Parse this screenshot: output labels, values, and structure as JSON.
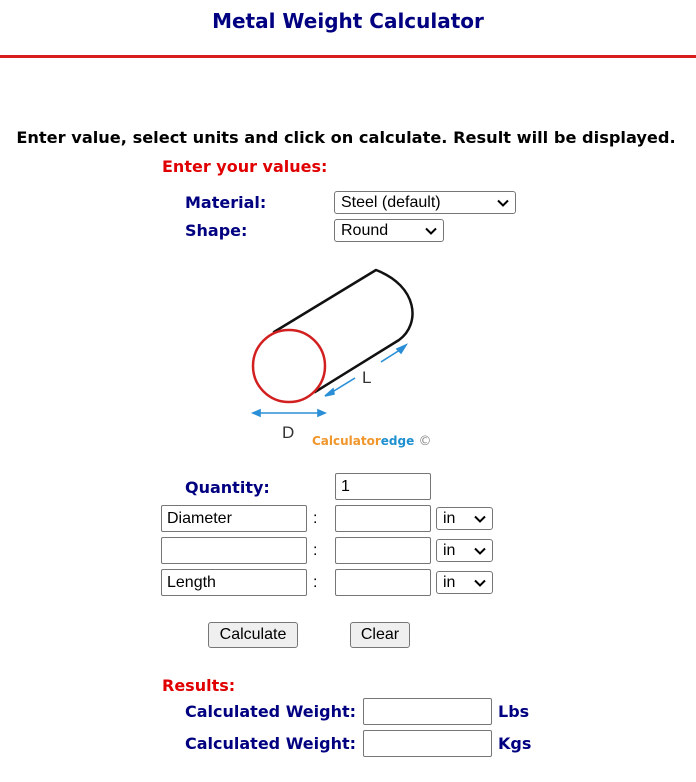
{
  "header": {
    "title": "Metal Weight Calculator"
  },
  "instructions": "Enter value, select units and click on calculate. Result will be displayed.",
  "colors": {
    "heading_blue": "#000080",
    "accent_red": "#e00000",
    "rule_red": "#d91c1c",
    "circle_red": "#d22020",
    "arrow_blue": "#2a8fd6",
    "brand_orange": "#f0962a",
    "brand_blue": "#1e90d0"
  },
  "form": {
    "section_heading": "Enter your values:",
    "material": {
      "label": "Material:",
      "selected": "Steel (default)"
    },
    "shape": {
      "label": "Shape:",
      "selected": "Round"
    },
    "diagram": {
      "length_label": "L",
      "diameter_label": "D",
      "brand_part1": "Calculator",
      "brand_part2": "edge",
      "brand_symbol": "©"
    },
    "quantity": {
      "label": "Quantity:",
      "value": "1"
    },
    "dimensions": [
      {
        "label": "Diameter",
        "separator": ":",
        "value": "",
        "unit": "in"
      },
      {
        "label": "",
        "separator": ":",
        "value": "",
        "unit": "in"
      },
      {
        "label": "Length",
        "separator": ":",
        "value": "",
        "unit": "in"
      }
    ],
    "buttons": {
      "calculate": "Calculate",
      "clear": "Clear"
    }
  },
  "results": {
    "heading": "Results:",
    "rows": [
      {
        "label": "Calculated Weight:",
        "value": "",
        "unit": "Lbs"
      },
      {
        "label": "Calculated Weight:",
        "value": "",
        "unit": "Kgs"
      }
    ]
  }
}
